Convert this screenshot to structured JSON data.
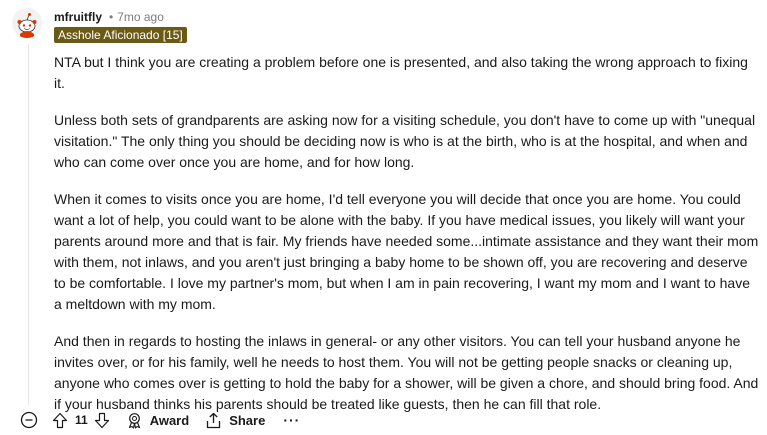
{
  "comment": {
    "author": "mfruitfly",
    "separator": "•",
    "timestamp": "7mo ago",
    "flair": "Asshole Aficionado [15]",
    "paragraphs": [
      "NTA but I think you are creating a problem before one is presented, and also taking the wrong approach to fixing it.",
      "Unless both sets of grandparents are asking now for a visiting schedule, you don't have to come up with \"unequal visitation.\" The only thing you should be deciding now is who is at the birth, who is at the hospital, and when and who can come over once you are home, and for how long.",
      "When it comes to visits once you are home, I'd tell everyone you will decide that once you are home. You could want a lot of help, you could want to be alone with the baby. If you have medical issues, you likely will want your parents around more and that is fair. My friends have needed some...intimate assistance and they want their mom with them, not inlaws, and you aren't just bringing a baby home to be shown off, you are recovering and deserve to be comfortable. I love my partner's mom, but when I am in pain recovering, I want my mom and I want to have a meltdown with my mom.",
      "And then in regards to hosting the inlaws in general- or any other visitors. You can tell your husband anyone he invites over, or for his family, well he needs to host them. You will not be getting people snacks or cleaning up, anyone who comes over is getting to hold the baby for a shower, will be given a chore, and should bring food. And if your husband thinks his parents should be treated like guests, then he can fill that role."
    ]
  },
  "actions": {
    "vote_count": "11",
    "award_label": "Award",
    "share_label": "Share",
    "more_label": "···"
  },
  "icons": {
    "avatar": "snoo-avatar-icon",
    "collapse": "collapse-minus-icon",
    "upvote": "upvote-arrow-icon",
    "downvote": "downvote-arrow-icon",
    "award": "award-icon",
    "share": "share-icon"
  },
  "colors": {
    "flair_background": "#6b5a16",
    "flair_text": "#ffffff",
    "text": "#1a1a1b",
    "muted": "#7c7c7c"
  }
}
